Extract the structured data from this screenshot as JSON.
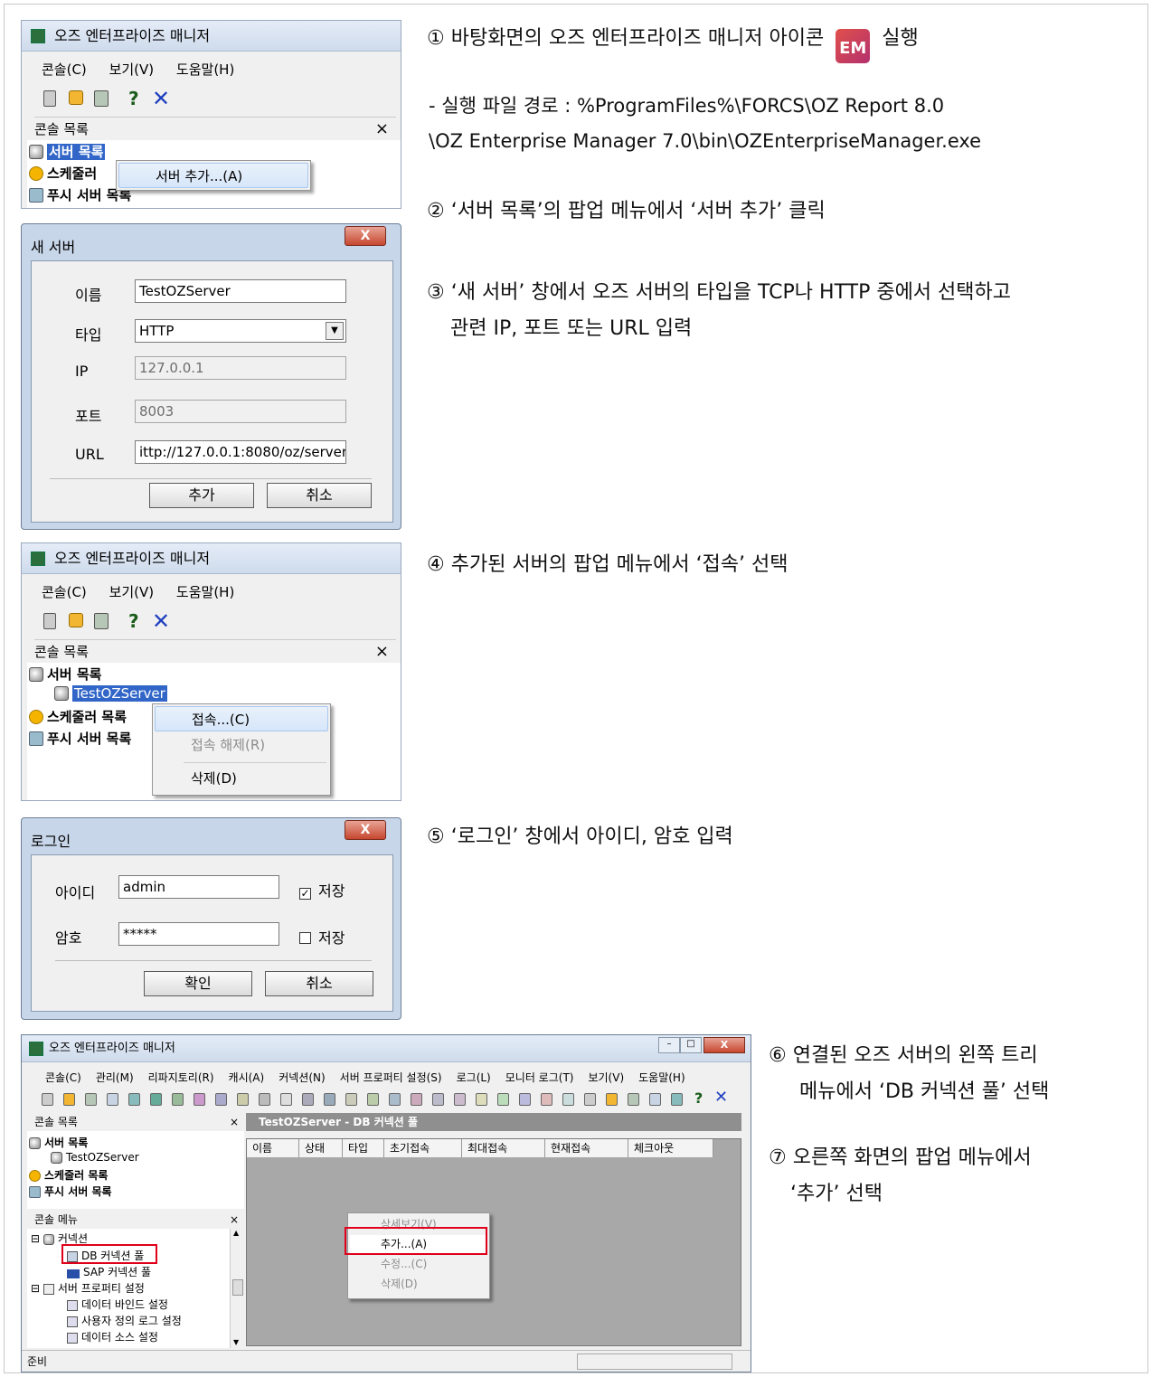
{
  "instructions": {
    "step1_prefix": "① 바탕화면의 오즈 엔터프라이즈 매니저 아이콘",
    "step1_suffix": "실행",
    "step1_path_line1": "- 실행 파일 경로 : %ProgramFiles%\\FORCS\\OZ Report 8.0",
    "step1_path_line2": "\\OZ Enterprise Manager 7.0\\bin\\OZEnterpriseManager.exe",
    "step2": "② ‘서버 목록’의 팝업 메뉴에서 ‘서버 추가’ 클릭",
    "step3_line1": "③ ‘새 서버’ 창에서 오즈 서버의 타입을 TCP나 HTTP 중에서 선택하고",
    "step3_line2": "관련 IP, 포트 또는 URL 입력",
    "step4": "④ 추가된 서버의 팝업 메뉴에서 ‘접속’ 선택",
    "step5": "⑤ ‘로그인’ 창에서 아이디, 암호 입력",
    "step6_line1": "⑥ 연결된 오즈 서버의 왼쪽 트리",
    "step6_line2": "메뉴에서 ‘DB 커넥션 풀’ 선택",
    "step7_line1": "⑦ 오른쪽 화면의 팝업 메뉴에서",
    "step7_line2": "‘추가’ 선택"
  },
  "desktop_icon_label": "EM",
  "app": {
    "title": "오즈 엔터프라이즈 매니저",
    "menu_console": "콘솔(C)",
    "menu_view": "보기(V)",
    "menu_help": "도움말(H)",
    "console_list": "콘솔 목록",
    "close_glyph": "×",
    "server_list": "서버 목록",
    "scheduler": "스케줄러",
    "scheduler_list": "스케줄러 목록",
    "push_server_list": "푸시 서버 목록",
    "push_server_list_partial": "푸시 서버 목록"
  },
  "popup1": {
    "add_server": "서버 추가...(A)"
  },
  "new_server": {
    "title": "새 서버",
    "close": "X",
    "name_label": "이름",
    "name_value": "TestOZServer",
    "type_label": "타입",
    "type_value": "HTTP",
    "ip_label": "IP",
    "ip_value": "127.0.0.1",
    "port_label": "포트",
    "port_value": "8003",
    "url_label": "URL",
    "url_value": "ittp://127.0.0.1:8080/oz/server",
    "add_button": "추가",
    "cancel_button": "취소"
  },
  "shot3": {
    "server_node": "TestOZServer",
    "connect": "접속...(C)",
    "disconnect": "접속 해제(R)",
    "delete": "삭제(D)"
  },
  "login": {
    "title": "로그인",
    "close": "X",
    "id_label": "아이디",
    "id_value": "admin",
    "save1_label": "저장",
    "pw_label": "암호",
    "pw_value": "*****",
    "save2_label": "저장",
    "ok_button": "확인",
    "cancel_button": "취소"
  },
  "shot5": {
    "title": "오즈 엔터프라이즈 매니저",
    "menus": [
      "콘솔(C)",
      "관리(M)",
      "리파지토리(R)",
      "캐시(A)",
      "커넥션(N)",
      "서버 프로퍼티 설정(S)",
      "로그(L)",
      "모니터 로그(T)",
      "보기(V)",
      "도움말(H)"
    ],
    "console_list": "콘솔 목록",
    "server_list": "서버 목록",
    "server_node": "TestOZServer",
    "scheduler_list": "스케줄러 목록",
    "push_server_list": "푸시 서버 목록",
    "console_menu": "콘솔 메뉴",
    "tree": {
      "connection": "커넥션",
      "db_pool": "DB 커넥션 풀",
      "sap_pool": "SAP 커넥션 풀",
      "server_props": "서버 프로퍼티 설정",
      "data_bind": "데이터 바인드 설정",
      "user_log": "사용자 정의 로그 설정",
      "data_source": "데이터 소스 설정"
    },
    "panel_title": "TestOZServer - DB 커넥션 풀",
    "columns": [
      "이름",
      "상태",
      "타입",
      "초기접속",
      "최대접속",
      "현재접속",
      "체크아웃"
    ],
    "ctx": {
      "detail": "상세보기(V)",
      "add": "추가...(A)",
      "edit": "수정...(C)",
      "delete": "삭제(D)"
    },
    "status": "준비"
  }
}
